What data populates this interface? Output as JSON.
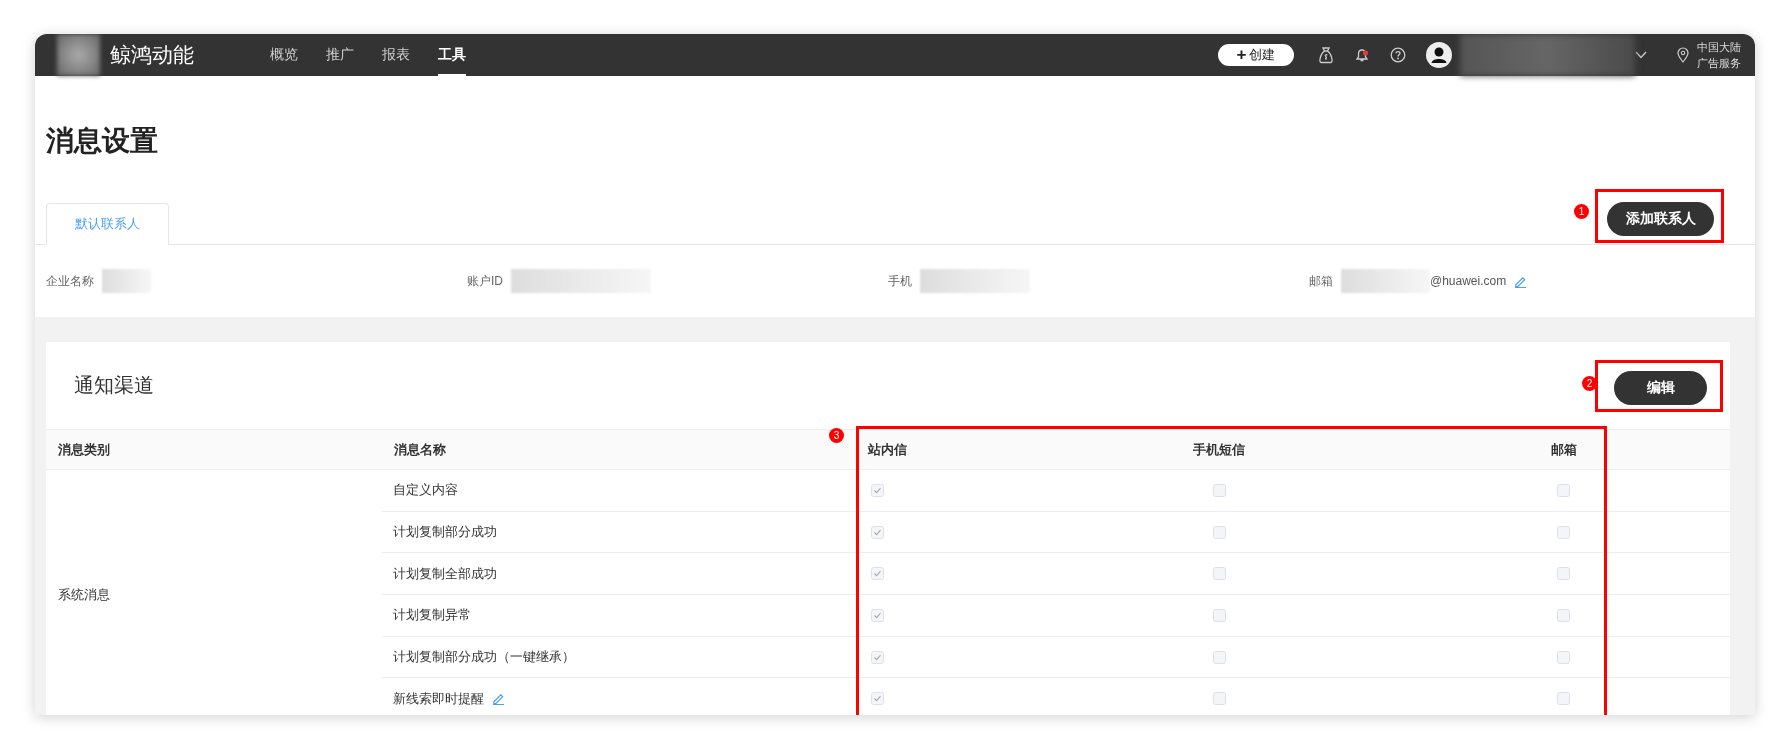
{
  "topbar": {
    "brand": "鲸鸿动能",
    "nav": [
      {
        "label": "概览",
        "selected": false
      },
      {
        "label": "推广",
        "selected": false
      },
      {
        "label": "报表",
        "selected": false
      },
      {
        "label": "工具",
        "selected": true
      }
    ],
    "create_button": {
      "icon": "+",
      "label": "创建"
    },
    "region": [
      "中国大陆",
      "广告服务"
    ]
  },
  "page_title": "消息设置",
  "tabs": [
    {
      "label": "默认联系人",
      "selected": true
    }
  ],
  "add_contact_button": {
    "label": "添加联系人",
    "annotation": "1"
  },
  "contact_fields": [
    {
      "label": "企业名称",
      "kind": "plain"
    },
    {
      "label": "账户ID",
      "kind": "plain"
    },
    {
      "label": "手机",
      "kind": "plain"
    },
    {
      "label": "邮箱",
      "kind": "email",
      "suffix": "@huawei.com"
    }
  ],
  "channels": {
    "title": "通知渠道",
    "edit_button": {
      "label": "编辑",
      "annotation": "2"
    },
    "channel_annotation": "3",
    "columns": [
      "消息类别",
      "消息名称",
      "站内信",
      "手机短信",
      "邮箱"
    ],
    "groups": [
      {
        "category": "系统消息",
        "rows": [
          {
            "name": "自定义内容",
            "editable": false,
            "in_app": true,
            "sms": false,
            "email": false,
            "disabled": true
          },
          {
            "name": "计划复制部分成功",
            "editable": false,
            "in_app": true,
            "sms": false,
            "email": false,
            "disabled": true
          },
          {
            "name": "计划复制全部成功",
            "editable": false,
            "in_app": true,
            "sms": false,
            "email": false,
            "disabled": true
          },
          {
            "name": "计划复制异常",
            "editable": false,
            "in_app": true,
            "sms": false,
            "email": false,
            "disabled": true
          },
          {
            "name": "计划复制部分成功（一键继承）",
            "editable": false,
            "in_app": true,
            "sms": false,
            "email": false,
            "disabled": true
          },
          {
            "name": "新线索即时提醒",
            "editable": true,
            "in_app": true,
            "sms": false,
            "email": false,
            "disabled": true
          }
        ]
      }
    ]
  }
}
